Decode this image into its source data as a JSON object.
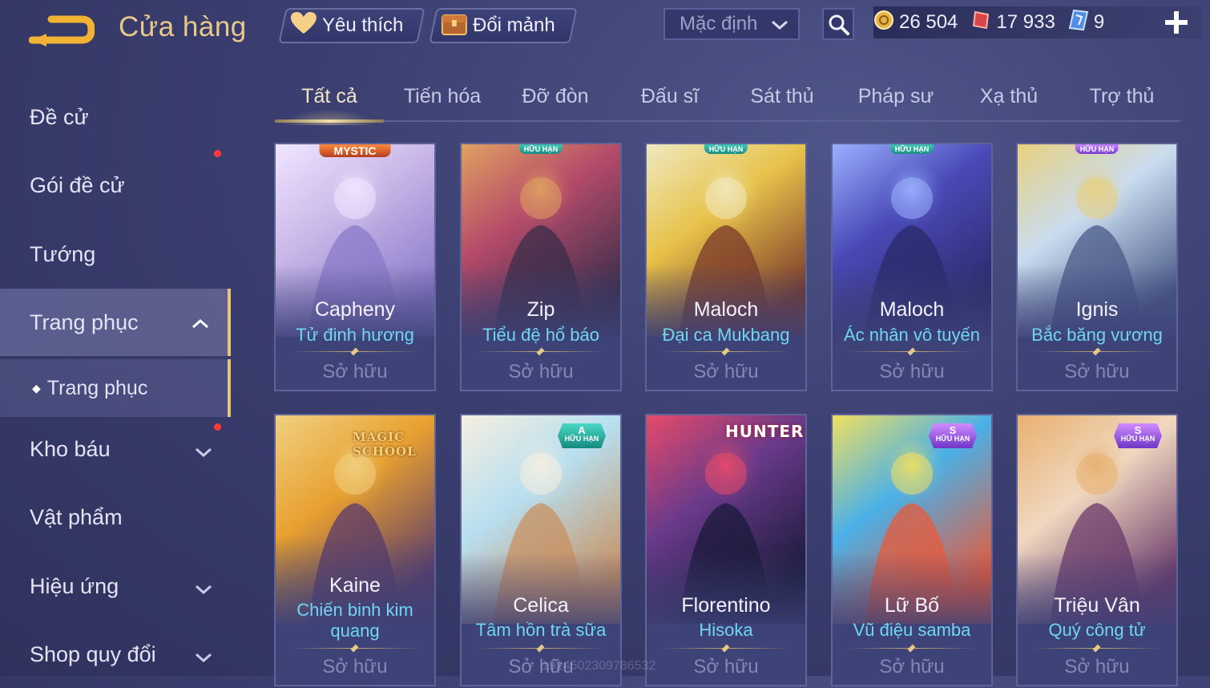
{
  "header": {
    "title": "Cửa hàng",
    "favorites_label": "Yêu thích",
    "shard_exchange_label": "Đổi mảnh",
    "sort_value": "Mặc định",
    "currencies": [
      {
        "icon": "gold-coin-icon",
        "value": "26 504"
      },
      {
        "icon": "red-voucher-icon",
        "value": "17 933"
      },
      {
        "icon": "blue-crystal-icon",
        "value": "9"
      }
    ]
  },
  "sidebar": {
    "items": [
      {
        "label": "Đề cử"
      },
      {
        "label": "Gói đề cử"
      },
      {
        "label": "Tướng"
      },
      {
        "label": "Trang phục"
      },
      {
        "label": "Trang phục"
      },
      {
        "label": "Kho báu"
      },
      {
        "label": "Vật phẩm"
      },
      {
        "label": "Hiệu ứng"
      },
      {
        "label": "Shop quy đổi"
      }
    ]
  },
  "tabs": [
    {
      "label": "Tất cả"
    },
    {
      "label": "Tiến hóa"
    },
    {
      "label": "Đỡ đòn"
    },
    {
      "label": "Đấu sĩ"
    },
    {
      "label": "Sát thủ"
    },
    {
      "label": "Pháp sư"
    },
    {
      "label": "Xạ thủ"
    },
    {
      "label": "Trợ thủ"
    }
  ],
  "cards": [
    {
      "hero": "Capheny",
      "skin": "Tử đinh hương",
      "status": "Sở hữu",
      "badge": "MYSTIC",
      "colors": [
        "#c9b7e8",
        "#8a79c9",
        "#f0e6ff"
      ]
    },
    {
      "hero": "Zip",
      "skin": "Tiểu đệ hổ báo",
      "status": "Sở hữu",
      "badge": "HỮU HẠN",
      "colors": [
        "#b44a6a",
        "#3a2e4a",
        "#e0a060"
      ]
    },
    {
      "hero": "Maloch",
      "skin": "Đại ca Mukbang",
      "status": "Sở hữu",
      "badge": "HỮU HẠN",
      "colors": [
        "#e7c24a",
        "#7a3a2a",
        "#f0e9c0"
      ]
    },
    {
      "hero": "Maloch",
      "skin": "Ác nhân vô tuyến",
      "status": "Sở hữu",
      "badge": "HỮU HẠN",
      "colors": [
        "#4a4ab8",
        "#2a2a6a",
        "#9ab0ff"
      ]
    },
    {
      "hero": "Ignis",
      "skin": "Bắc băng vương",
      "status": "Sở hữu",
      "badge": "HỮU HẠN",
      "colors": [
        "#c9dcef",
        "#4a5a88",
        "#e8d080"
      ]
    },
    {
      "hero": "Kaine",
      "skin": "Chiến binh kim quang",
      "status": "Sở hữu",
      "logo": "MAGIC SCHOOL",
      "colors": [
        "#e8a030",
        "#5a3a6a",
        "#f0d080"
      ]
    },
    {
      "hero": "Celica",
      "skin": "Tâm hồn trà sữa",
      "status": "Sở hữu",
      "rank": "A",
      "rank_sub": "HỮU HẠN",
      "colors": [
        "#b8dff0",
        "#c89060",
        "#f6efe0"
      ]
    },
    {
      "hero": "Florentino",
      "skin": "Hisoka",
      "status": "Sở hữu",
      "logo": "HUNTER×HUNTER",
      "colors": [
        "#6a3a8a",
        "#1a1a3a",
        "#e64a6a"
      ]
    },
    {
      "hero": "Lữ Bố",
      "skin": "Vũ điệu samba",
      "status": "Sở hữu",
      "rank": "S",
      "rank_sub": "HỮU HẠN",
      "colors": [
        "#4ab0e8",
        "#e85a3a",
        "#f0e060"
      ]
    },
    {
      "hero": "Triệu Vân",
      "skin": "Quý công tử",
      "status": "Sở hữu",
      "rank": "S",
      "rank_sub": "HỮU HẠN",
      "colors": [
        "#f0d8c0",
        "#6a3a6a",
        "#e8b070"
      ]
    }
  ],
  "watermark": "1914502309786532"
}
